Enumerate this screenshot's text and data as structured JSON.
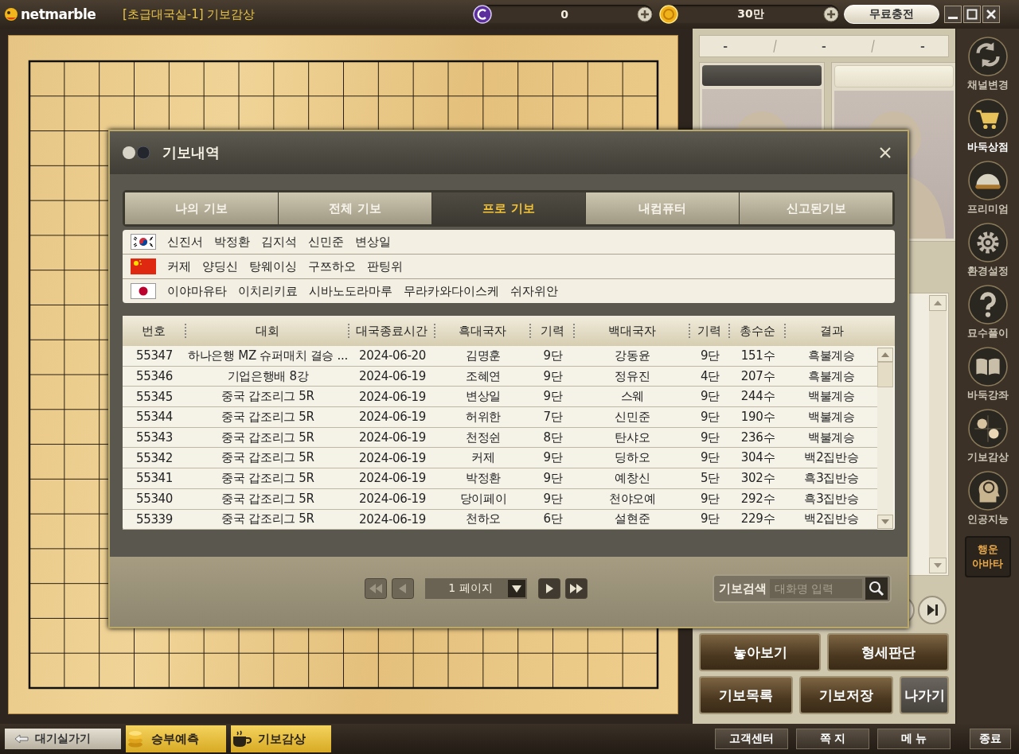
{
  "top_bar": {
    "logo": "netmarble",
    "title": "[초급대국실-1] 기보감상",
    "balances": [
      {
        "kind": "cash",
        "amount": "0"
      },
      {
        "kind": "gold",
        "amount": "30만"
      }
    ],
    "charge_button": "무료충전"
  },
  "score_bar": [
    "-",
    "-",
    "-"
  ],
  "players": [
    {
      "kind": "black"
    },
    {
      "kind": "white"
    }
  ],
  "nav_buttons": [
    {
      "kind": "next"
    },
    {
      "kind": "last"
    }
  ],
  "action_rows": [
    [
      {
        "label": "놓아보기",
        "kind": "primary"
      },
      {
        "label": "형세판단",
        "kind": "primary"
      }
    ],
    [
      {
        "label": "기보목록",
        "kind": "primary"
      },
      {
        "label": "기보저장",
        "kind": "primary"
      },
      {
        "label": "나가기",
        "kind": "secondary"
      }
    ]
  ],
  "sidebar": [
    {
      "label": "채널변경",
      "kind": "refresh",
      "selected": false
    },
    {
      "label": "바둑상점",
      "kind": "cart",
      "selected": true
    },
    {
      "label": "프리미엄",
      "kind": "helmet",
      "selected": false
    },
    {
      "label": "환경설정",
      "kind": "gear",
      "selected": false
    },
    {
      "label": "묘수풀이",
      "kind": "question",
      "selected": false
    },
    {
      "label": "바둑강좌",
      "kind": "book",
      "selected": false
    },
    {
      "label": "기보감상",
      "kind": "stones",
      "selected": false
    },
    {
      "label": "인공지능",
      "kind": "head",
      "selected": false
    },
    {
      "label": "행운 아바타",
      "kind": "badge",
      "selected": false
    }
  ],
  "bottom_bar": {
    "left": [
      {
        "label": "대기실가기",
        "kind": "back"
      },
      {
        "label": "승부예측",
        "kind": "coins"
      },
      {
        "label": "기보감상",
        "kind": "cup"
      }
    ],
    "right": [
      {
        "label": "고객센터",
        "kind": "link"
      },
      {
        "label": "쪽 지",
        "kind": "link"
      },
      {
        "label": "메 뉴",
        "kind": "link"
      },
      {
        "label": "종료",
        "kind": "exit"
      }
    ]
  },
  "dialog": {
    "title": "기보내역",
    "tabs": [
      {
        "label": "나의 기보",
        "selected": false
      },
      {
        "label": "전체 기보",
        "selected": false
      },
      {
        "label": "프로 기보",
        "selected": true
      },
      {
        "label": "내컴퓨터",
        "selected": false
      },
      {
        "label": "신고된기보",
        "selected": false
      }
    ],
    "players": [
      {
        "kind": "kr",
        "names": [
          "신진서",
          "박정환",
          "김지석",
          "신민준",
          "변상일"
        ]
      },
      {
        "kind": "cn",
        "names": [
          "커제",
          "양딩신",
          "탕웨이싱",
          "구쯔하오",
          "판팅위"
        ]
      },
      {
        "kind": "jp",
        "names": [
          "이야마유타",
          "이치리키료",
          "시바노도라마루",
          "무라카와다이스케",
          "쉬자위안"
        ]
      }
    ],
    "table": {
      "columns": [
        "번호",
        "대회",
        "대국종료시간",
        "흑대국자",
        "기력",
        "백대국자",
        "기력",
        "총수순",
        "결과"
      ],
      "rows": [
        [
          "55347",
          "하나은행 MZ 슈퍼매치 결승 ...",
          "2024-06-20",
          "김명훈",
          "9단",
          "강동윤",
          "9단",
          "151수",
          "흑불계승"
        ],
        [
          "55346",
          "기업은행배 8강",
          "2024-06-19",
          "조혜연",
          "9단",
          "정유진",
          "4단",
          "207수",
          "흑불계승"
        ],
        [
          "55345",
          "중국 갑조리그 5R",
          "2024-06-19",
          "변상일",
          "9단",
          "스웨",
          "9단",
          "244수",
          "백불계승"
        ],
        [
          "55344",
          "중국 갑조리그 5R",
          "2024-06-19",
          "허위한",
          "7단",
          "신민준",
          "9단",
          "190수",
          "백불계승"
        ],
        [
          "55343",
          "중국 갑조리그 5R",
          "2024-06-19",
          "천정쉰",
          "8단",
          "탄샤오",
          "9단",
          "236수",
          "백불계승"
        ],
        [
          "55342",
          "중국 갑조리그 5R",
          "2024-06-19",
          "커제",
          "9단",
          "딩하오",
          "9단",
          "304수",
          "백2집반승"
        ],
        [
          "55341",
          "중국 갑조리그 5R",
          "2024-06-19",
          "박정환",
          "9단",
          "예창신",
          "5단",
          "302수",
          "흑3집반승"
        ],
        [
          "55340",
          "중국 갑조리그 5R",
          "2024-06-19",
          "당이페이",
          "9단",
          "천야오예",
          "9단",
          "292수",
          "흑3집반승"
        ],
        [
          "55339",
          "중국 갑조리그 5R",
          "2024-06-19",
          "천하오",
          "6단",
          "설현준",
          "9단",
          "229수",
          "백2집반승"
        ]
      ]
    },
    "pagination": {
      "page": "1 페이지"
    },
    "search": {
      "label": "기보검색",
      "placeholder": "대화명 입력"
    }
  }
}
